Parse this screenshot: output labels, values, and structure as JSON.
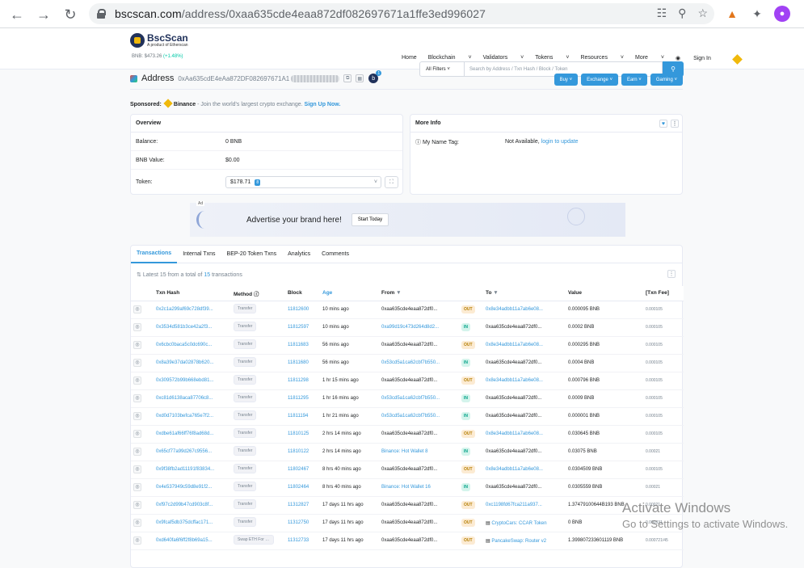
{
  "browser": {
    "url_domain": "bscscan.com",
    "url_path": "/address/0xaa635cde4eaa872df082697671a1ffe3ed996027"
  },
  "header": {
    "logo_name": "BscScan",
    "logo_sub": "A product of Etherscan",
    "bnb_price": "BNB: $473.26",
    "bnb_change": "(+1.48%)",
    "filter": "All Filters",
    "search_placeholder": "Search by Address / Txn Hash / Block / Token",
    "nav": [
      "Home",
      "Blockchain",
      "Validators",
      "Tokens",
      "Resources",
      "More",
      "Sign In"
    ]
  },
  "address": {
    "label": "Address",
    "hash": "0xAa635cdE4eAa872DF082697671A1",
    "badge": "b",
    "badge_count": "1",
    "buttons": [
      "Buy",
      "Exchange",
      "Earn",
      "Gaming"
    ]
  },
  "sponsored": {
    "label": "Sponsored:",
    "brand": "Binance",
    "text": "- Join the world's largest crypto exchange.",
    "cta": "Sign Up Now."
  },
  "overview": {
    "title": "Overview",
    "balance_label": "Balance:",
    "balance_value": "0 BNB",
    "value_label": "BNB Value:",
    "value_value": "$0.00",
    "token_label": "Token:",
    "token_value": "$178.71",
    "token_count": "8"
  },
  "more_info": {
    "title": "More Info",
    "tag_label": "My Name Tag:",
    "tag_value": "Not Available,",
    "tag_link": "login to update"
  },
  "ad": {
    "tag": "Ad",
    "text": "Advertise your brand here!",
    "button": "Start Today"
  },
  "transactions": {
    "tabs": [
      "Transactions",
      "Internal Txns",
      "BEP-20 Token Txns",
      "Analytics",
      "Comments"
    ],
    "latest_prefix": "Latest 15 from a total of",
    "latest_count": "15",
    "latest_suffix": "transactions",
    "columns": [
      "Txn Hash",
      "Method",
      "Block",
      "Age",
      "From",
      "",
      "To",
      "Value",
      "[Txn Fee]"
    ],
    "rows": [
      {
        "hash": "0x2c1a299af69c728df39...",
        "method": "Transfer",
        "block": "11812600",
        "age": "10 mins ago",
        "from": "0xaa635cde4eaa872df0...",
        "from_link": false,
        "dir": "OUT",
        "to": "0x8e34adbb11a7ab6e08...",
        "value": "0.000095 BNB",
        "fee": "0.000105"
      },
      {
        "hash": "0x3534d581b3ce42a2f3...",
        "method": "Transfer",
        "block": "11812597",
        "age": "10 mins ago",
        "from": "0xa99d19c473d264d8d2...",
        "from_link": true,
        "dir": "IN",
        "to": "0xaa635cde4eaa872df0...",
        "value": "0.0002 BNB",
        "fee": "0.000105"
      },
      {
        "hash": "0x6cbc0baca5c0dc690c...",
        "method": "Transfer",
        "block": "11811683",
        "age": "56 mins ago",
        "from": "0xaa635cde4eaa872df0...",
        "from_link": false,
        "dir": "OUT",
        "to": "0x8e34adbb11a7ab6e08...",
        "value": "0.000295 BNB",
        "fee": "0.000105"
      },
      {
        "hash": "0x8a39e37da02878b620...",
        "method": "Transfer",
        "block": "11811680",
        "age": "56 mins ago",
        "from": "0x53cd5a1ca62cbf7b550...",
        "from_link": true,
        "dir": "IN",
        "to": "0xaa635cde4eaa872df0...",
        "value": "0.0004 BNB",
        "fee": "0.000105"
      },
      {
        "hash": "0x309572b99b668ebd81...",
        "method": "Transfer",
        "block": "11811298",
        "age": "1 hr 15 mins ago",
        "from": "0xaa635cde4eaa872df0...",
        "from_link": false,
        "dir": "OUT",
        "to": "0x8e34adbb11a7ab6e08...",
        "value": "0.000796 BNB",
        "fee": "0.000105"
      },
      {
        "hash": "0xc81d6138aca87706c8...",
        "method": "Transfer",
        "block": "11811295",
        "age": "1 hr 16 mins ago",
        "from": "0x53cd5a1ca62cbf7b550...",
        "from_link": true,
        "dir": "IN",
        "to": "0xaa635cde4eaa872df0...",
        "value": "0.0009 BNB",
        "fee": "0.000105"
      },
      {
        "hash": "0xd0d7103befca765e7f2...",
        "method": "Transfer",
        "block": "11811194",
        "age": "1 hr 21 mins ago",
        "from": "0x53cd5a1ca62cbf7b550...",
        "from_link": true,
        "dir": "IN",
        "to": "0xaa635cde4eaa872df0...",
        "value": "0.000001 BNB",
        "fee": "0.000105"
      },
      {
        "hash": "0xdbe61af66ff76f8ad68d...",
        "method": "Transfer",
        "block": "11810125",
        "age": "2 hrs 14 mins ago",
        "from": "0xaa635cde4eaa872df0...",
        "from_link": false,
        "dir": "OUT",
        "to": "0x8e34adbb11a7ab6e08...",
        "value": "0.030645 BNB",
        "fee": "0.000105"
      },
      {
        "hash": "0x65cf77a99d267c9556...",
        "method": "Transfer",
        "block": "11810122",
        "age": "2 hrs 14 mins ago",
        "from": "Binance: Hot Wallet 8",
        "from_link": true,
        "dir": "IN",
        "to": "0xaa635cde4eaa872df0...",
        "value": "0.03075 BNB",
        "fee": "0.00021"
      },
      {
        "hash": "0x9f38fb2ad11191f83834...",
        "method": "Transfer",
        "block": "11802467",
        "age": "8 hrs 40 mins ago",
        "from": "0xaa635cde4eaa872df0...",
        "from_link": false,
        "dir": "OUT",
        "to": "0x8e34adbb11a7ab6e08...",
        "value": "0.0304509 BNB",
        "fee": "0.000105"
      },
      {
        "hash": "0x4e537949c59d8e91f2...",
        "method": "Transfer",
        "block": "11802464",
        "age": "8 hrs 40 mins ago",
        "from": "Binance: Hot Wallet 16",
        "from_link": true,
        "dir": "IN",
        "to": "0xaa635cde4eaa872df0...",
        "value": "0.0305559 BNB",
        "fee": "0.00021"
      },
      {
        "hash": "0xf97c2d99b47cd903c8f...",
        "method": "Transfer",
        "block": "11312827",
        "age": "17 days 11 hrs ago",
        "from": "0xaa635cde4eaa872df0...",
        "from_link": false,
        "dir": "OUT",
        "to": "0xc1198fd67fca211a937...",
        "value": "1.37479100644B193 BNB",
        "fee": "0.00021"
      },
      {
        "hash": "0x9fcaf5db375dcffac171...",
        "method": "Transfer",
        "block": "11312750",
        "age": "17 days 11 hrs ago",
        "from": "0xaa635cde4eaa872df0...",
        "from_link": false,
        "dir": "OUT",
        "to": "CryptoCars: CCAR Token",
        "value": "0 BNB",
        "fee": "0.000331"
      },
      {
        "hash": "0xd640fa6f6ff2f8b69a15...",
        "method": "Swap ETH For Exa...",
        "block": "11312733",
        "age": "17 days 11 hrs ago",
        "from": "0xaa635cde4eaa872df0...",
        "from_link": false,
        "dir": "OUT",
        "to": "PancakeSwap: Router v2",
        "value": "1.399807233601119 BNB",
        "fee": "0.000721/45"
      }
    ]
  },
  "watermark": {
    "title": "Activate Windows",
    "subtitle": "Go to Settings to activate Windows."
  }
}
